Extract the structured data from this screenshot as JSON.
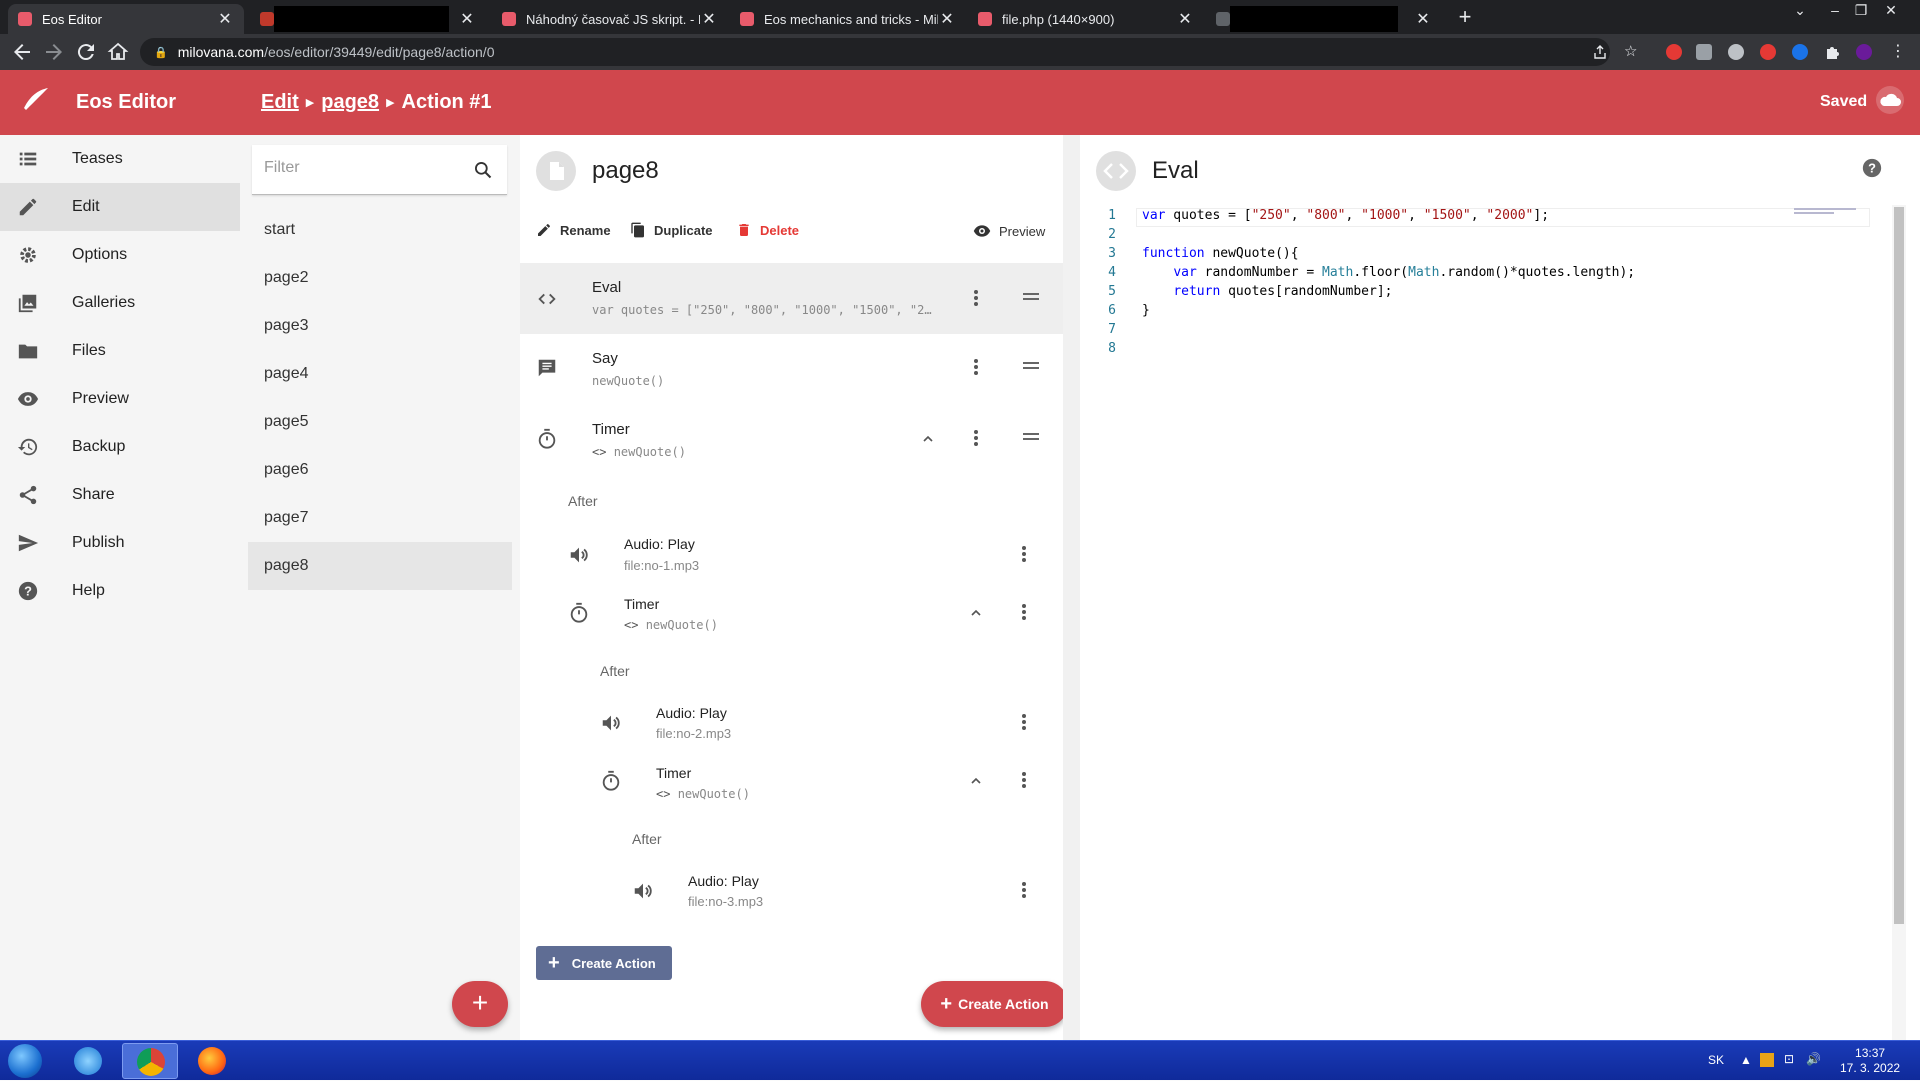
{
  "browser": {
    "tabs": [
      {
        "title": "Eos Editor",
        "active": true
      },
      {
        "title": "",
        "active": false
      },
      {
        "title": "Náhodný časovač JS skript. - Milo",
        "active": false
      },
      {
        "title": "Eos mechanics and tricks - Milova",
        "active": false
      },
      {
        "title": "file.php (1440×900)",
        "active": false
      },
      {
        "title": "",
        "active": false
      }
    ],
    "url_host": "milovana.com",
    "url_path": "/eos/editor/39449/edit/page8/action/0"
  },
  "app": {
    "title": "Eos Editor",
    "breadcrumb": {
      "edit": "Edit",
      "page": "page8",
      "action": "Action #1"
    },
    "status": "Saved",
    "accent": "#d0474d"
  },
  "nav": {
    "items": [
      {
        "label": "Teases",
        "icon": "list-icon"
      },
      {
        "label": "Edit",
        "icon": "pencil-icon",
        "active": true
      },
      {
        "label": "Options",
        "icon": "gear-icon"
      },
      {
        "label": "Galleries",
        "icon": "gallery-icon"
      },
      {
        "label": "Files",
        "icon": "folder-icon"
      },
      {
        "label": "Preview",
        "icon": "eye-icon"
      },
      {
        "label": "Backup",
        "icon": "history-icon"
      },
      {
        "label": "Share",
        "icon": "share-icon"
      },
      {
        "label": "Publish",
        "icon": "send-icon"
      },
      {
        "label": "Help",
        "icon": "help-icon"
      }
    ]
  },
  "pages": {
    "filter_placeholder": "Filter",
    "items": [
      "start",
      "page2",
      "page3",
      "page4",
      "page5",
      "page6",
      "page7",
      "page8"
    ],
    "add_label": "+"
  },
  "actions": {
    "page_name": "page8",
    "toolbar": {
      "rename": "Rename",
      "duplicate": "Duplicate",
      "delete": "Delete",
      "preview": "Preview"
    },
    "list": [
      {
        "title": "Eval",
        "sub": "var quotes = [\"250\", \"800\", \"1000\", \"1500\", \"2…"
      },
      {
        "title": "Say",
        "sub": "newQuote()"
      },
      {
        "title": "Timer",
        "sub": "newQuote()"
      }
    ],
    "after_label": "After",
    "nested": [
      {
        "title": "Audio: Play",
        "sub": "file:no-1.mp3"
      },
      {
        "title": "Timer",
        "sub": "newQuote()"
      },
      {
        "title": "Audio: Play",
        "sub": "file:no-2.mp3"
      },
      {
        "title": "Timer",
        "sub": "newQuote()"
      },
      {
        "title": "Audio: Play",
        "sub": "file:no-3.mp3"
      }
    ],
    "create_label": "Create Action"
  },
  "editor": {
    "title": "Eval",
    "lines": [
      {
        "n": "1",
        "code": "var quotes = [\"250\", \"800\", \"1000\", \"1500\", \"2000\"];"
      },
      {
        "n": "2",
        "code": ""
      },
      {
        "n": "3",
        "code": "function newQuote(){"
      },
      {
        "n": "4",
        "code": "    var randomNumber = Math.floor(Math.random()*quotes.length);"
      },
      {
        "n": "5",
        "code": "    return quotes[randomNumber];"
      },
      {
        "n": "6",
        "code": "}"
      },
      {
        "n": "7",
        "code": ""
      },
      {
        "n": "8",
        "code": ""
      }
    ]
  },
  "taskbar": {
    "lang": "SK",
    "time": "13:37",
    "date": "17. 3. 2022"
  }
}
